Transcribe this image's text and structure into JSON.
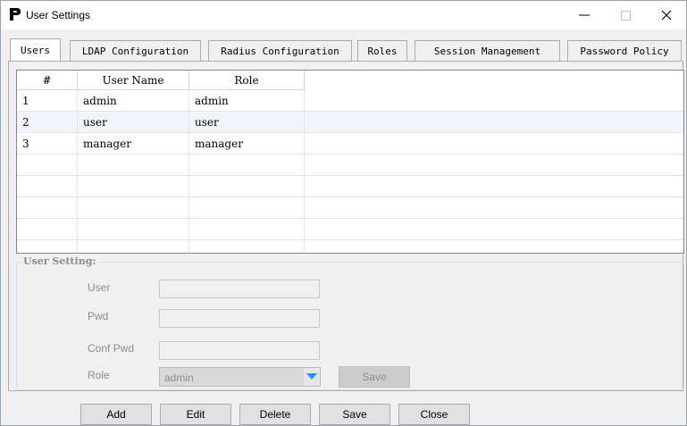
{
  "window": {
    "title": "User Settings",
    "controls": {
      "minimize": "—",
      "maximize": "☐",
      "close": "✕"
    }
  },
  "tabs": [
    {
      "label": "Users",
      "active": true
    },
    {
      "label": "LDAP Configuration"
    },
    {
      "label": "Radius Configuration"
    },
    {
      "label": "Roles"
    },
    {
      "label": "Session Management"
    },
    {
      "label": "Password Policy"
    }
  ],
  "users_table": {
    "columns": [
      "#",
      "User Name",
      "Role"
    ],
    "rows": [
      {
        "num": "1",
        "name": "admin",
        "role": "admin"
      },
      {
        "num": "2",
        "name": "user",
        "role": "user"
      },
      {
        "num": "3",
        "name": "manager",
        "role": "manager"
      }
    ]
  },
  "user_setting": {
    "group_label": "User Setting:",
    "fields": {
      "user_label": "User",
      "user_value": "",
      "pwd_label": "Pwd",
      "pwd_value": "",
      "conf_pwd_label": "Conf Pwd",
      "conf_pwd_value": "",
      "role_label": "Role",
      "role_value": "admin"
    },
    "save_label": "Save"
  },
  "bottom_buttons": {
    "add": "Add",
    "edit": "Edit",
    "delete": "Delete",
    "save": "Save",
    "close": "Close"
  },
  "colors": {
    "accent": "#1e90ff",
    "disabled_text": "#8d8d8d"
  }
}
